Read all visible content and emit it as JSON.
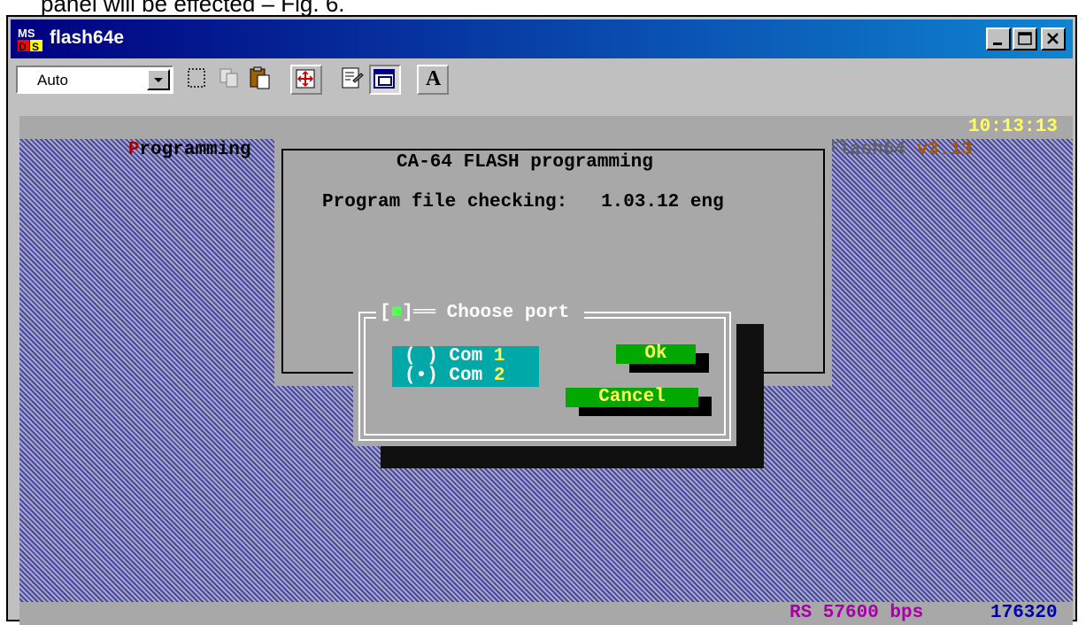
{
  "document": {
    "top_text": "panel will be effected – Fig. 6."
  },
  "window": {
    "title": "flash64e",
    "icon": "ms-dos-icon",
    "controls": [
      "minimize-icon",
      "maximize-icon",
      "close-icon"
    ]
  },
  "toolbar": {
    "font_size_value": "Auto",
    "tools": [
      "mark-icon",
      "copy-icon",
      "paste-icon",
      "full-screen-icon",
      "properties-icon",
      "background-icon",
      "font-icon"
    ],
    "font_button_label": "A"
  },
  "console": {
    "top_left_label": "P",
    "top_left_label_rest": "rogramming",
    "app_name": "Flash64 ",
    "version": "v3.13",
    "clock": "10:13:13",
    "panel": {
      "title": "CA-64 FLASH programming",
      "line_label": "Program file checking:",
      "line_value": "1.03.12 eng"
    },
    "dialog": {
      "title_bracket_left": "[",
      "title_mark": "■",
      "title_bracket_right": "]",
      "title_rule": "══",
      "title": "Choose port",
      "options": [
        {
          "marker": "( )",
          "label": "Com ",
          "number": "1",
          "selected": false
        },
        {
          "marker": "(•)",
          "label": "Com ",
          "number": "2",
          "selected": true
        }
      ],
      "ok_label": "Ok",
      "cancel_label": "Cancel"
    },
    "status": {
      "rs": "RS 57600 bps",
      "counter": "176320"
    },
    "colors": {
      "background_pattern": "#4848a0",
      "bar": "#a8a8a8",
      "button_green": "#00a800",
      "radio_cyan": "#00a8a8"
    }
  }
}
